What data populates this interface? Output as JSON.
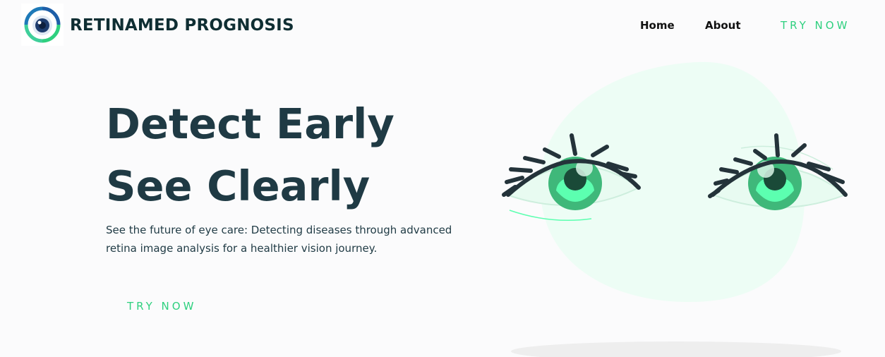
{
  "header": {
    "brand": "RETINAMED PROGNOSIS",
    "logo_icon": "eye-logo-icon",
    "nav": {
      "home": "Home",
      "about": "About",
      "try_now": "TRY NOW"
    }
  },
  "hero": {
    "title_line1": "Detect Early",
    "title_line2": "See Clearly",
    "description": "See the future of eye care: Detecting diseases through advanced retina image analysis for a healthier vision journey.",
    "cta": "TRY NOW",
    "illustration_icon": "eyes-illustration"
  },
  "colors": {
    "accent": "#2fd07f",
    "heading": "#1f3a44",
    "iris": "#3fb87a",
    "iris_light": "#5cffb0",
    "pupil": "#1a4a38",
    "lash": "#24333a",
    "bg_circle": "#edfdf5"
  }
}
